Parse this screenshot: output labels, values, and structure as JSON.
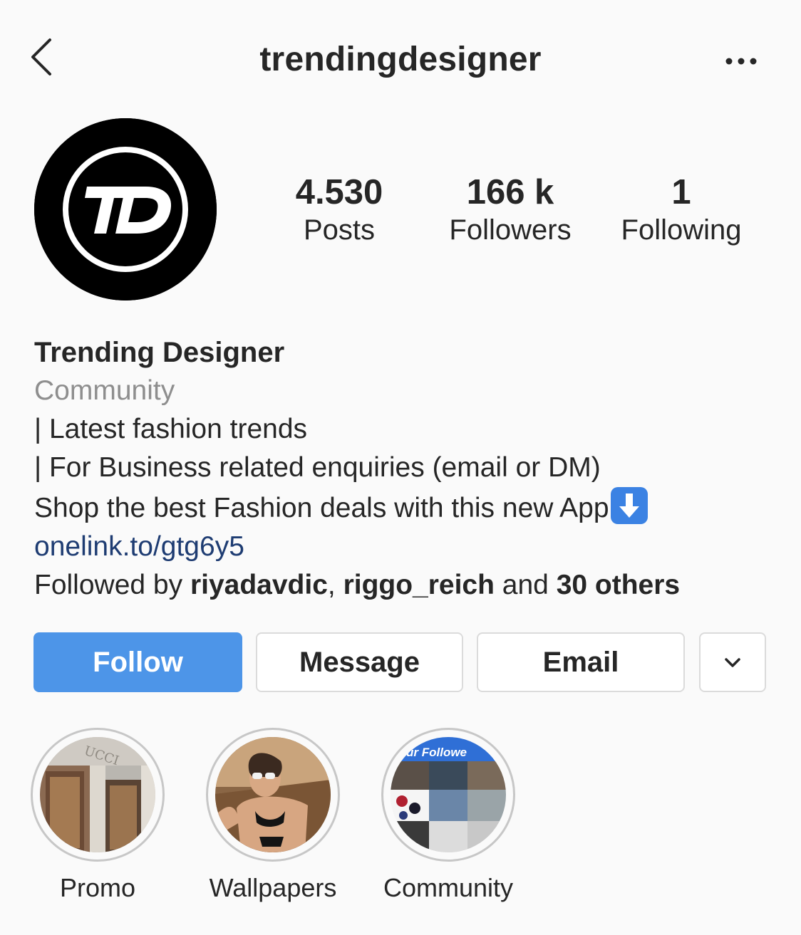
{
  "header": {
    "username": "trendingdesigner",
    "back_icon": "chevron-left-icon",
    "more_icon": "ellipsis-icon"
  },
  "avatar": {
    "logo_text": "TD"
  },
  "stats": {
    "posts": {
      "value": "4.530",
      "label": "Posts"
    },
    "followers": {
      "value": "166 k",
      "label": "Followers"
    },
    "following": {
      "value": "1",
      "label": "Following"
    }
  },
  "bio": {
    "name": "Trending Designer",
    "category": "Community",
    "line1": "| Latest fashion trends",
    "line2": "| For Business related enquiries (email or DM)",
    "line3": "Shop the best Fashion deals with this new App",
    "line3_emoji": "down-arrow-emoji",
    "link": "onelink.to/gtg6y5",
    "followed_by_prefix": "Followed by ",
    "followed_user1": "riyadavdic",
    "followed_sep": ", ",
    "followed_user2": "riggo_reich",
    "followed_and": " and ",
    "followed_others": "30 others"
  },
  "actions": {
    "follow": "Follow",
    "message": "Message",
    "email": "Email",
    "more_icon": "chevron-down-icon"
  },
  "highlights": [
    {
      "label": "Promo"
    },
    {
      "label": "Wallpapers"
    },
    {
      "label": "Community",
      "overlay_text": "ur Followe"
    }
  ],
  "colors": {
    "follow_button": "#4d95e8",
    "link": "#1e3c72",
    "secondary_text": "#8e8e8e",
    "background": "#fafafa"
  }
}
